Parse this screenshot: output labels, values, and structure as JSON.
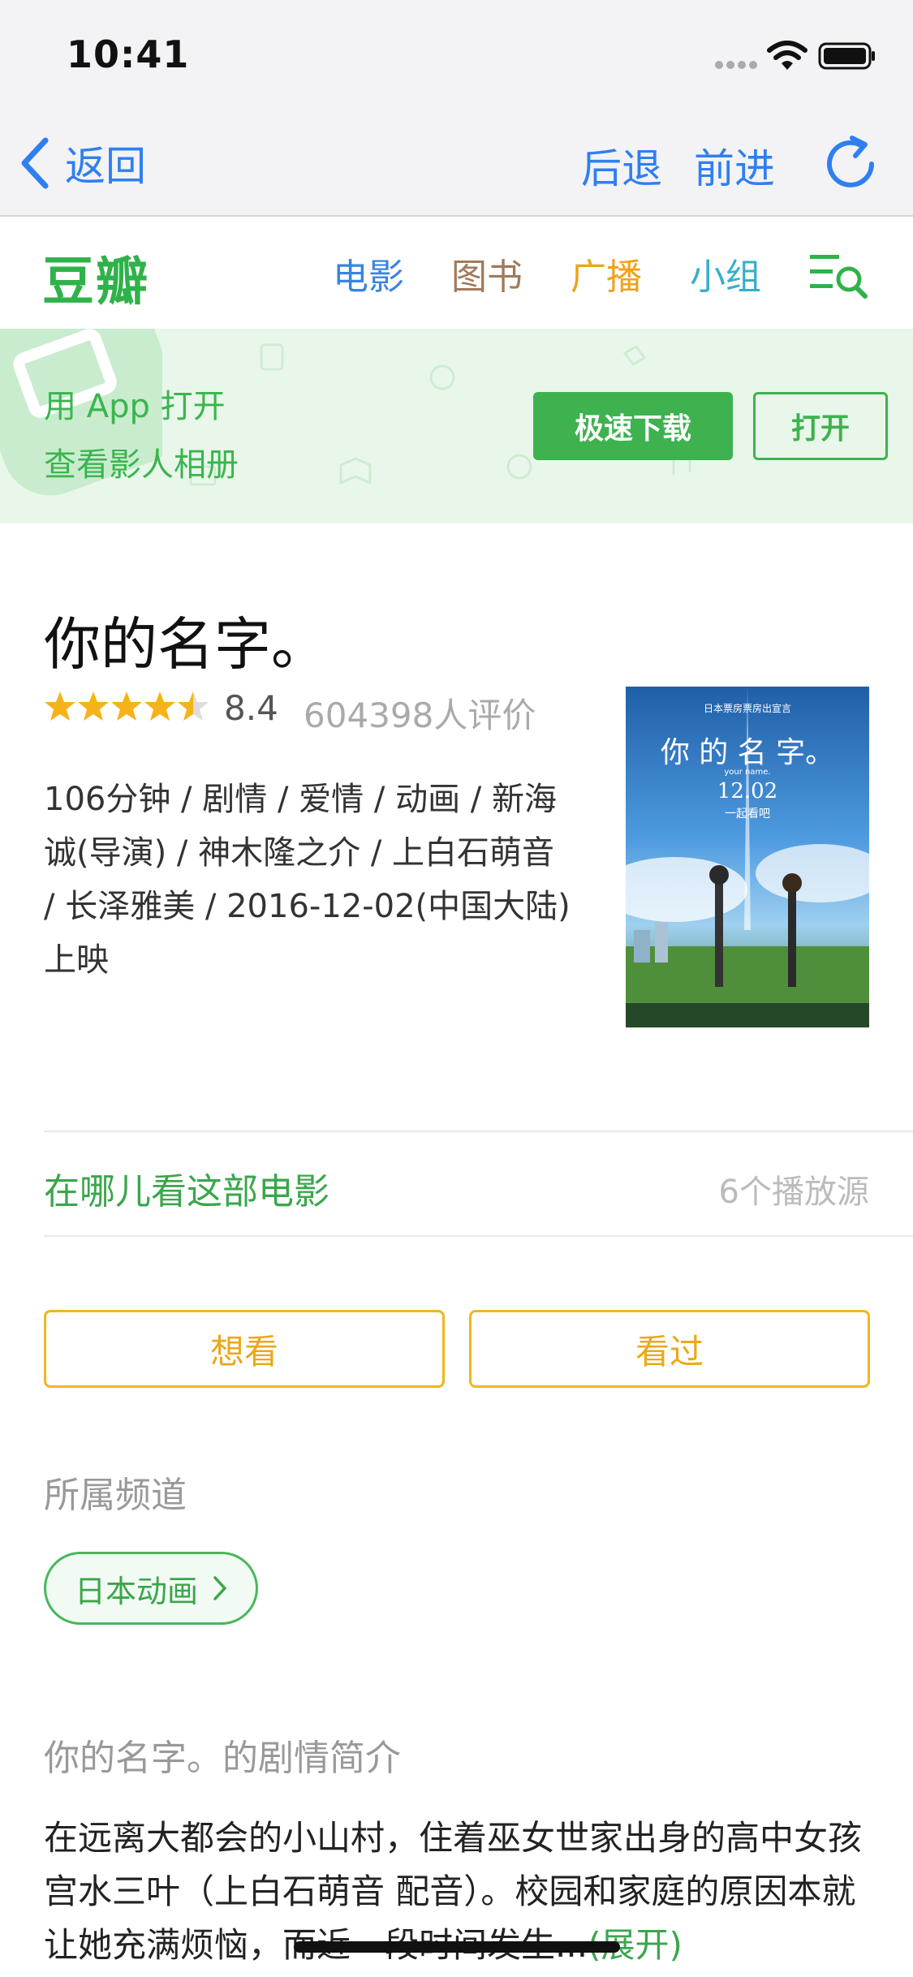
{
  "status_bar": {
    "time": "10:41"
  },
  "browser_nav": {
    "back_label": "返回",
    "backward_label": "后退",
    "forward_label": "前进"
  },
  "site_header": {
    "logo": "豆瓣",
    "nav": [
      {
        "label": "电影",
        "color": "#3a84e0"
      },
      {
        "label": "图书",
        "color": "#a07a5c"
      },
      {
        "label": "广播",
        "color": "#f0a21a"
      },
      {
        "label": "小组",
        "color": "#34b0c8"
      }
    ]
  },
  "app_banner": {
    "line1": "用 App 打开",
    "line2": "查看影人相册",
    "download_label": "极速下载",
    "open_label": "打开"
  },
  "movie": {
    "title": "你的名字。",
    "stars": 4.5,
    "rating": "8.4",
    "rating_count": "604398人评价",
    "meta": "106分钟 / 剧情 / 爱情 / 动画 / 新海诚(导演) / 神木隆之介 / 上白石萌音 / 长泽雅美 / 2016-12-02(中国大陆)上映"
  },
  "poster": {
    "top_caption": "日本票房票房出宣言",
    "title": "你 的 名 字。",
    "subtitle": "your name.",
    "date": "12.02",
    "date_sub": "一起看吧"
  },
  "where_to_watch": {
    "label": "在哪儿看这部电影",
    "sources": "6个播放源"
  },
  "actions": {
    "want_label": "想看",
    "watched_label": "看过"
  },
  "channels": {
    "heading": "所属频道",
    "tag": "日本动画"
  },
  "synopsis": {
    "heading": "你的名字。的剧情简介",
    "text": "在远离大都会的小山村，住着巫女世家出身的高中女孩宫水三叶（上白石萌音 配音）。校园和家庭的原因本就让她充满烦恼，而近一段时间发生...",
    "expand_label": "(展开)"
  }
}
